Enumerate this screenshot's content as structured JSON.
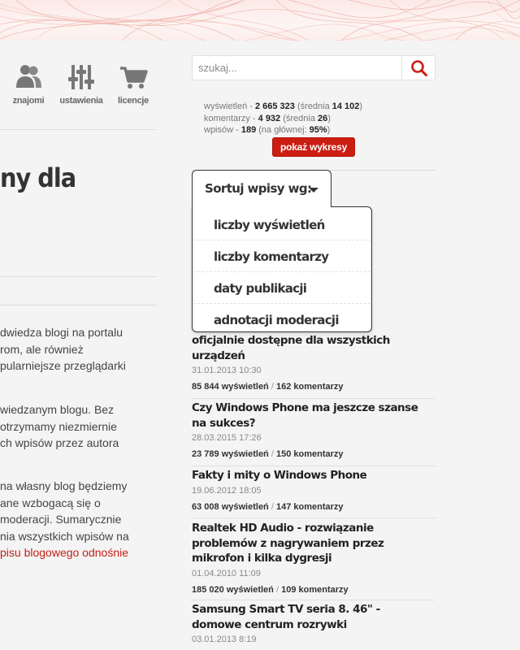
{
  "nav": [
    {
      "label": "znajomi",
      "icon": "friends-icon"
    },
    {
      "label": "ustawienia",
      "icon": "settings-sliders-icon"
    },
    {
      "label": "licencje",
      "icon": "cart-icon"
    }
  ],
  "left": {
    "title": "ny dla",
    "paragraphs": [
      [
        "dwiedza blogi na portalu",
        "rom, ale również",
        "pularniejsze przeglądarki"
      ],
      [
        "wiedzanym blogu. Bez",
        "otrzymamy niezmiernie",
        "ch wpisów przez autora"
      ],
      [
        "na własny blog będziemy",
        "ane wzbogacą się o",
        "moderacji. Sumarycznie",
        "nia wszystkich wpisów na"
      ],
      [
        "pisu blogowego odnośnie"
      ]
    ]
  },
  "search": {
    "placeholder": "szukaj...",
    "icon": "search-icon"
  },
  "stats": {
    "views_label": "wyświetleń - ",
    "views_value": "2 665 323",
    "views_avg_label": " (średnia ",
    "views_avg_value": "14 102",
    "views_avg_close": ")",
    "comments_label": "komentarzy - ",
    "comments_value": "4 932",
    "comments_avg_label": " (średnia ",
    "comments_avg_value": "26",
    "comments_avg_close": ")",
    "posts_label": "wpisów - ",
    "posts_value": "189",
    "posts_main_label": " (na głównej: ",
    "posts_main_value": "95%",
    "posts_main_close": ")",
    "charts_button": "pokaż wykresy",
    "accent_color": "#cc1d12"
  },
  "sort": {
    "label": "Sortuj wpisy wg:",
    "options": [
      "liczby wyświetleń",
      "liczby komentarzy",
      "daty publikacji",
      "adnotacji moderacji"
    ]
  },
  "posts": [
    {
      "title_lines": [
        "oficjalnie dostępne dla wszystkich",
        "urządzeń"
      ],
      "date": "31.01.2013 10:30",
      "views": "85 844 wyświetleń",
      "comments": "162 komentarzy"
    },
    {
      "title_lines": [
        "Czy Windows Phone ma jeszcze szanse",
        "na sukces?"
      ],
      "date": "28.03.2015 17:26",
      "views": "23 789 wyświetleń",
      "comments": "150 komentarzy"
    },
    {
      "title_lines": [
        "Fakty i mity o Windows Phone"
      ],
      "date": "19.06.2012 18:05",
      "views": "63 008 wyświetleń",
      "comments": "147 komentarzy"
    },
    {
      "title_lines": [
        "Realtek HD Audio - rozwiązanie",
        "problemów z nagrywaniem przez",
        "mikrofon i kilka dygresji"
      ],
      "date": "01.04.2010 11:09",
      "views": "185 020 wyświetleń",
      "comments": "109 komentarzy"
    },
    {
      "title_lines": [
        "Samsung Smart TV seria 8. 46\" -",
        "domowe centrum rozrywki"
      ],
      "date": "03.01.2013 8:19",
      "views": "",
      "comments": ""
    }
  ],
  "meta_separator": " / "
}
